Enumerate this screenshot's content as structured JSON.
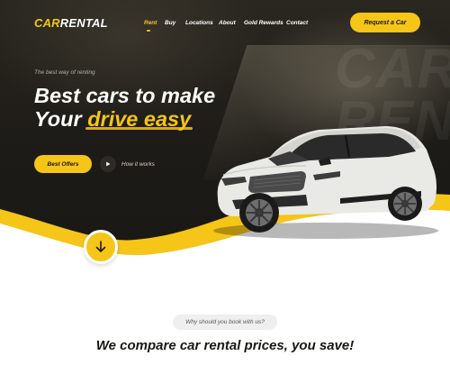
{
  "brand": {
    "part1": "CAR",
    "part2": "RENTAL"
  },
  "nav": {
    "items": [
      {
        "label": "Rent"
      },
      {
        "label": "Buy"
      },
      {
        "label": "Locations"
      },
      {
        "label": "About"
      },
      {
        "label": "Gold Rewards"
      },
      {
        "label": "Contact"
      }
    ],
    "active": "Rent"
  },
  "header": {
    "cta_label": "Request a Car"
  },
  "hero": {
    "tagline": "The best way of renting",
    "headline_line1": "Best cars to make",
    "headline_line2_prefix": "Your ",
    "headline_line2_highlight": "drive easy",
    "background_word": "CAR REN",
    "offers_label": "Best Offers",
    "how_label": "How it works"
  },
  "section": {
    "pill": "Why should you book with us?",
    "title_prefix": "We compare car rental prices, ",
    "title_highlight": "you save!"
  },
  "colors": {
    "accent": "#f5c518",
    "dark": "#1d1b17",
    "white": "#ffffff"
  },
  "icons": {
    "play": "play-icon",
    "down": "arrow-down-icon"
  }
}
